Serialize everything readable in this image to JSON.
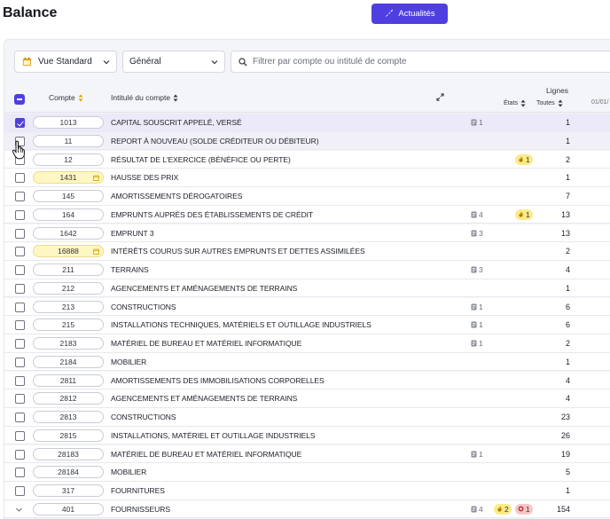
{
  "page": {
    "title": "Balance"
  },
  "header": {
    "news_label": "Actualités"
  },
  "filters": {
    "view": "Vue Standard",
    "category": "Général",
    "search_placeholder": "Filtrer par compte ou intitulé de compte"
  },
  "table": {
    "headers": {
      "compte": "Compte",
      "intitule": "Intitulé du compte",
      "lignes": "Lignes",
      "etats": "États",
      "toutes": "Toutes",
      "date_fragment": "01/01/"
    },
    "rows": [
      {
        "account": "1013",
        "label": "CAPITAL SOUSCRIT APPELÉ, VERSÉ",
        "docs": "1",
        "total": "1",
        "checked": true,
        "selected": true
      },
      {
        "account": "11",
        "label": "REPORT À NOUVEAU (SOLDE CRÉDITEUR OU DÉBITEUR)",
        "total": "1",
        "hover": true
      },
      {
        "account": "12",
        "label": "RÉSULTAT DE L'EXERCICE (BÉNÉFICE OU PERTE)",
        "warn": "1",
        "total": "2"
      },
      {
        "account": "1431",
        "label": "HAUSSE DES PRIX",
        "total": "1",
        "highlight": true
      },
      {
        "account": "145",
        "label": "AMORTISSEMENTS DÉROGATOIRES",
        "total": "7"
      },
      {
        "account": "164",
        "label": "EMPRUNTS AUPRÈS DES ÉTABLISSEMENTS DE CRÉDIT",
        "docs": "4",
        "warn": "1",
        "total": "13"
      },
      {
        "account": "1642",
        "label": "EMPRUNT 3",
        "docs": "3",
        "total": "13"
      },
      {
        "account": "16888",
        "label": "INTÉRÊTS COURUS SUR AUTRES EMPRUNTS ET DETTES ASSIMILÉES",
        "total": "2",
        "highlight": true
      },
      {
        "account": "211",
        "label": "TERRAINS",
        "docs": "3",
        "total": "4"
      },
      {
        "account": "212",
        "label": "AGENCEMENTS ET AMÉNAGEMENTS DE TERRAINS",
        "total": "1"
      },
      {
        "account": "213",
        "label": "CONSTRUCTIONS",
        "docs": "1",
        "total": "6"
      },
      {
        "account": "215",
        "label": "INSTALLATIONS TECHNIQUES, MATÉRIELS ET OUTILLAGE INDUSTRIELS",
        "docs": "1",
        "total": "6"
      },
      {
        "account": "2183",
        "label": "MATÉRIEL DE BUREAU ET MATÉRIEL INFORMATIQUE",
        "docs": "1",
        "total": "2"
      },
      {
        "account": "2184",
        "label": "MOBILIER",
        "total": "1"
      },
      {
        "account": "2811",
        "label": "AMORTISSEMENTS DES IMMOBILISATIONS CORPORELLES",
        "total": "4"
      },
      {
        "account": "2812",
        "label": "AGENCEMENTS ET AMÉNAGEMENTS DE TERRAINS",
        "total": "4"
      },
      {
        "account": "2813",
        "label": "CONSTRUCTIONS",
        "total": "23"
      },
      {
        "account": "2815",
        "label": "INSTALLATIONS, MATÉRIEL ET OUTILLAGE INDUSTRIELS",
        "total": "26"
      },
      {
        "account": "28183",
        "label": "MATÉRIEL DE BUREAU ET MATÉRIEL INFORMATIQUE",
        "docs": "1",
        "total": "19"
      },
      {
        "account": "28184",
        "label": "MOBILIER",
        "total": "5"
      },
      {
        "account": "317",
        "label": "FOURNITURES",
        "total": "1"
      },
      {
        "account": "401",
        "label": "FOURNISSEURS",
        "docs": "4",
        "warn": "2",
        "alert": "1",
        "total": "154",
        "expandable": true
      }
    ]
  },
  "colors": {
    "accent": "#4f3fe0",
    "highlight": "#fff7c2",
    "warn": "#fbeb88",
    "alert": "#f8c6c6"
  }
}
